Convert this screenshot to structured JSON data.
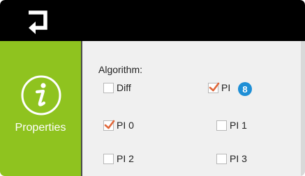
{
  "sidebar": {
    "label": "Properties",
    "icon": "info-icon",
    "color": "#8fc31f"
  },
  "topbar": {
    "back_icon": "back-arrow-icon"
  },
  "form": {
    "heading": "Algorithm:",
    "options": [
      {
        "label": "Diff",
        "checked": false
      },
      {
        "label": "PI",
        "checked": true
      },
      {
        "label": "PI 0",
        "checked": true
      },
      {
        "label": "PI 1",
        "checked": false
      },
      {
        "label": "PI 2",
        "checked": false
      },
      {
        "label": "PI 3",
        "checked": false
      }
    ],
    "badge": "8",
    "badge_color": "#1e8fd6",
    "check_color": "#e0673a"
  }
}
